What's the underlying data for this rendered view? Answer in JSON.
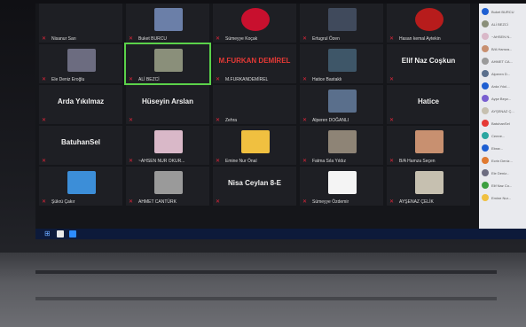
{
  "tiles": [
    {
      "name": "Nisanur Sarı",
      "col": 0,
      "row": 0,
      "kind": "dark"
    },
    {
      "name": "Buket BURCU",
      "col": 1,
      "row": 0,
      "kind": "photo",
      "color": "#6b7fa8"
    },
    {
      "name": "Sümeyye Koçak",
      "col": 2,
      "row": 0,
      "kind": "logo",
      "color": "#c8102e"
    },
    {
      "name": "Ertugrul Özen",
      "col": 3,
      "row": 0,
      "kind": "photo",
      "color": "#404a5c"
    },
    {
      "name": "Hasan kemal Aytekin",
      "col": 4,
      "row": 0,
      "kind": "logo",
      "color": "#b71c1c"
    },
    {
      "name": "Ele Deniz Eroğlu",
      "col": 0,
      "row": 1,
      "kind": "photo",
      "color": "#6c6c80"
    },
    {
      "name": "ALİ BEZCİ",
      "col": 1,
      "row": 1,
      "kind": "photo",
      "color": "#8a8f7a",
      "active": true
    },
    {
      "name": "M.FURKANDEMİREL",
      "col": 2,
      "row": 1,
      "kind": "text",
      "big": "M.FURKAN DEMİREL",
      "bigColor": "#e53935"
    },
    {
      "name": "Hatice Bastaklı",
      "col": 3,
      "row": 1,
      "kind": "photo",
      "color": "#3e5668"
    },
    {
      "name": "",
      "col": 4,
      "row": 1,
      "kind": "text",
      "big": "Elif Naz Coşkun"
    },
    {
      "name": "",
      "col": 0,
      "row": 2,
      "kind": "text",
      "big": "Arda Yıkılmaz"
    },
    {
      "name": "",
      "col": 1,
      "row": 2,
      "kind": "text",
      "big": "Hüseyin Arslan"
    },
    {
      "name": "Zehra",
      "col": 2,
      "row": 2,
      "kind": "dark"
    },
    {
      "name": "Alperen DOĞANLI",
      "col": 3,
      "row": 2,
      "kind": "photo",
      "color": "#5a6f8c"
    },
    {
      "name": "",
      "col": 4,
      "row": 2,
      "kind": "text",
      "big": "Hatice"
    },
    {
      "name": "",
      "col": 0,
      "row": 3,
      "kind": "text",
      "big": "BatuhanSel"
    },
    {
      "name": "~AHSEN NUR OKUR...",
      "col": 1,
      "row": 3,
      "kind": "photo",
      "color": "#d9b8c8"
    },
    {
      "name": "Emine Nur Önal",
      "col": 2,
      "row": 3,
      "kind": "photo",
      "color": "#f0c040"
    },
    {
      "name": "Fatma Sıla Yıldız",
      "col": 3,
      "row": 3,
      "kind": "photo",
      "color": "#8e8476"
    },
    {
      "name": "B/A Hamza Seçen",
      "col": 4,
      "row": 3,
      "kind": "photo",
      "color": "#c89070"
    },
    {
      "name": "Şükrü Çakır",
      "col": 0,
      "row": 4,
      "kind": "photo",
      "color": "#3c8ed8"
    },
    {
      "name": "AHMET CANTÜRK",
      "col": 1,
      "row": 4,
      "kind": "photo",
      "color": "#9a9a9a"
    },
    {
      "name": "",
      "col": 2,
      "row": 4,
      "kind": "text",
      "big": "Nisa Ceylan 8-E"
    },
    {
      "name": "Sümeyye Özdemir",
      "col": 3,
      "row": 4,
      "kind": "photo",
      "color": "#f4f4f4"
    },
    {
      "name": "AYŞENAZ ÇELİK",
      "col": 4,
      "row": 4,
      "kind": "photo",
      "color": "#c6c0b0"
    }
  ],
  "sidebar": {
    "items": [
      {
        "label": "Buket BURCU",
        "color": "#1e5fd2"
      },
      {
        "label": "ALİ BEZCİ",
        "color": "#8a8f7a"
      },
      {
        "label": "~AHSEN N...",
        "color": "#d9b8c8"
      },
      {
        "label": "B/A Hamza...",
        "color": "#c89070"
      },
      {
        "label": "AHMET CA...",
        "color": "#9a9a9a"
      },
      {
        "label": "Alperen D...",
        "color": "#5a6f8c"
      },
      {
        "label": "Arda Yıkıl...",
        "color": "#1e5fd2"
      },
      {
        "label": "Ayşe Beyz...",
        "color": "#7a5fd0"
      },
      {
        "label": "AYŞENAZ Ç...",
        "color": "#c6c0b0"
      },
      {
        "label": "BatuhanSel",
        "color": "#e53935"
      },
      {
        "label": "Cemre...",
        "color": "#2aa6a0"
      },
      {
        "label": "Ebrar...",
        "color": "#1e5fd2"
      },
      {
        "label": "Ecrin Deniz...",
        "color": "#e07a30"
      },
      {
        "label": "Ele Deniz...",
        "color": "#6c6c80"
      },
      {
        "label": "Elif Naz Co...",
        "color": "#3c9f40"
      },
      {
        "label": "Emine Nur...",
        "color": "#f0c040"
      }
    ]
  }
}
